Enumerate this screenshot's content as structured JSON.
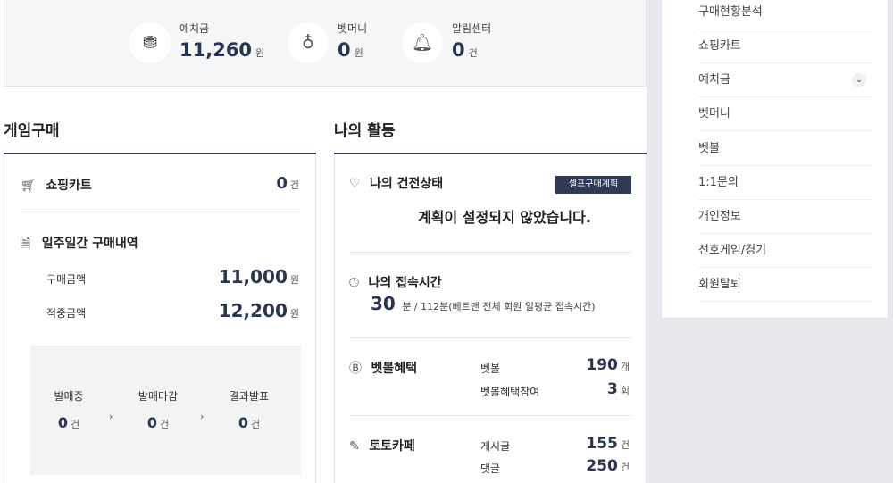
{
  "summary": [
    {
      "icon": "coin-stack-icon",
      "label": "예치금",
      "value": "11,260",
      "unit": "원"
    },
    {
      "icon": "money-bag-icon",
      "label": "벳머니",
      "value": "0",
      "unit": "원"
    },
    {
      "icon": "bell-icon",
      "label": "알림센터",
      "value": "0",
      "unit": "건"
    }
  ],
  "purchase": {
    "title": "게임구매",
    "cart_label": "쇼핑카트",
    "cart_value": "0",
    "cart_unit": "건",
    "weekly_title": "일주일간 구매내역",
    "buy_amount_label": "구매금액",
    "buy_amount_value": "11,000",
    "hit_amount_label": "적중금액",
    "hit_amount_value": "12,200",
    "won_unit": "원",
    "stages": [
      {
        "label": "발매중",
        "value": "0",
        "unit": "건"
      },
      {
        "label": "발매마감",
        "value": "0",
        "unit": "건"
      },
      {
        "label": "결과발표",
        "value": "0",
        "unit": "건"
      }
    ],
    "stage_arrow": "›"
  },
  "activity": {
    "title": "나의 활동",
    "health_label": "나의 건전상태",
    "self_plan_badge": "셀프구매계획",
    "health_message": "계획이 설정되지 않았습니다.",
    "access_label": "나의 접속시간",
    "access_value": "30",
    "access_detail": "분 / 112분(베트맨 전체 회원 일평균 접속시간)",
    "betball_label": "벳볼혜택",
    "betball_rows": [
      {
        "label": "벳볼",
        "value": "190",
        "unit": "개"
      },
      {
        "label": "벳볼혜택참여",
        "value": "3",
        "unit": "회"
      }
    ],
    "toto_label": "토토카페",
    "toto_rows": [
      {
        "label": "게시글",
        "value": "155",
        "unit": "건"
      },
      {
        "label": "댓글",
        "value": "250",
        "unit": "건"
      }
    ]
  },
  "side_menu": [
    "구매현황분석",
    "쇼핑카트",
    "예치금",
    "벳머니",
    "벳볼",
    "1:1문의",
    "개인정보",
    "선호게임/경기",
    "회원탈퇴"
  ],
  "colors": {
    "accent": "#2a3550",
    "badge": "#2f3a56",
    "sidebar_bg": "#e7e9ee"
  }
}
